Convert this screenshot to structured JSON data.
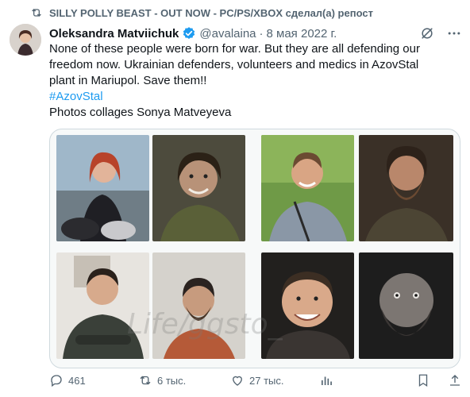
{
  "repost": {
    "text": "SILLY POLLY BEAST - OUT NOW - PC/PS/XBOX сделал(а) репост"
  },
  "tweet": {
    "author_name": "Oleksandra Matviichuk",
    "handle": "@avalaina",
    "separator": "·",
    "date": "8 мая 2022 г.",
    "text_line1": "None of these people were born for war. But they are all defending our",
    "text_line2": "freedom now. Ukrainian defenders, volunteers and medics in AzovStal",
    "text_line3": "plant in Mariupol. Save them!!",
    "hashtag": "#AzovStal",
    "credit": "Photos collages Sonya Matveyeva"
  },
  "photos": [
    "woman-on-motorcycle",
    "woman-smiling-dirty-face",
    "man-smiling-outdoors",
    "bearded-man-dark",
    "man-arms-crossed",
    "man-hospital-room",
    "man-smiling-closeup",
    "bearded-man-portrait"
  ],
  "actions": {
    "replies": "461",
    "reposts": "6 тыс.",
    "likes": "27 тыс.",
    "views": ""
  },
  "icons": {
    "repost": "repost-icon",
    "verified": "verified-badge-icon",
    "grok": "grok-icon",
    "more": "more-icon",
    "reply": "reply-icon",
    "like": "heart-icon",
    "views": "views-icon",
    "bookmark": "bookmark-icon",
    "share": "share-icon"
  },
  "colors": {
    "accent": "#1d9bf0",
    "muted": "#536471",
    "text": "#0f1419"
  }
}
